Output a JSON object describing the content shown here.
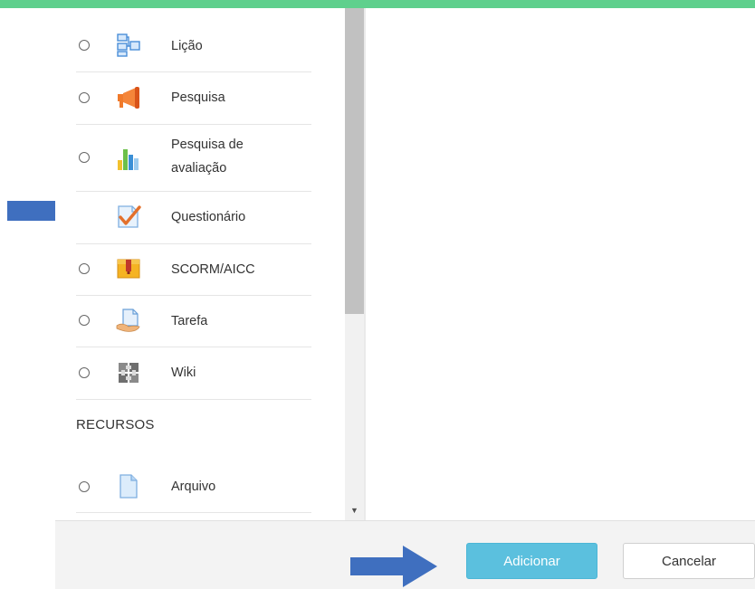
{
  "activities": [
    {
      "label": "Lição",
      "icon": "lesson-icon",
      "selected": false
    },
    {
      "label": "Pesquisa",
      "icon": "megaphone-icon",
      "selected": false
    },
    {
      "label": "Pesquisa de avaliação",
      "label_line1": "Pesquisa de",
      "label_line2": "avaliação",
      "icon": "bar-chart-icon",
      "selected": false
    },
    {
      "label": "Questionário",
      "icon": "quiz-checkmark-icon",
      "selected": false
    },
    {
      "label": "SCORM/AICC",
      "icon": "scorm-package-icon",
      "selected": false
    },
    {
      "label": "Tarefa",
      "icon": "assignment-hand-icon",
      "selected": false
    },
    {
      "label": "Wiki",
      "icon": "wiki-puzzle-icon",
      "selected": false
    }
  ],
  "resources_heading": "RECURSOS",
  "resources": [
    {
      "label": "Arquivo",
      "icon": "file-icon",
      "selected": false
    }
  ],
  "footer": {
    "add_label": "Adicionar",
    "cancel_label": "Cancelar"
  },
  "colors": {
    "accent_top": "#5fd08d",
    "primary_button": "#5bc0de",
    "annotation_arrow": "#3f6fbf"
  }
}
